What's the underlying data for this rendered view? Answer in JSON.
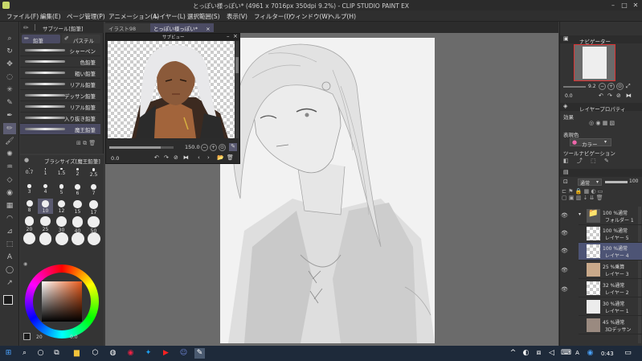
{
  "window": {
    "title": "とっぽい様っぽい* (4961 x 7016px 350dpi 9.2%) - CLIP STUDIO PAINT EX"
  },
  "menu": [
    "ファイル(F)",
    "編集(E)",
    "ページ管理(P)",
    "アニメーション(A)",
    "レイヤー(L)",
    "選択範囲(S)",
    "表示(V)",
    "フィルター(I)",
    "ウィンドウ(W)",
    "ヘルプ(H)"
  ],
  "doc_tabs": [
    {
      "label": "イラスト98",
      "active": false
    },
    {
      "label": "とっぽい様っぽい*",
      "active": true
    }
  ],
  "subtool": {
    "header": "サブツール[鉛筆]",
    "tabs": [
      "鉛筆",
      "パステル"
    ],
    "brushes": [
      "シャーペン",
      "色鉛筆",
      "粗い鉛筆",
      "リアル鉛筆",
      "デッサン鉛筆",
      "リアル鉛筆",
      "入り抜き鉛筆",
      "魔王鉛筆"
    ],
    "selected_brush": "魔王鉛筆"
  },
  "brush_size": {
    "header": "ブラシサイズ[魔王鉛筆]",
    "sizes": [
      "0.7",
      "1",
      "1.5",
      "2",
      "2.5",
      "3",
      "4",
      "5",
      "6",
      "7",
      "8",
      "10",
      "12",
      "15",
      "17",
      "20",
      "25",
      "30",
      "40",
      "50",
      "",
      "",
      "",
      "",
      ""
    ],
    "selected": "10"
  },
  "preview": {
    "header": "サブビュー",
    "zoom": "150.0",
    "rotation": "0.0"
  },
  "navigator": {
    "header": "ナビゲーター",
    "zoom": "9.2",
    "rotation": "0.0"
  },
  "layer_property": {
    "header": "レイヤープロパティ",
    "effect_label": "効果",
    "expression_label": "表現色",
    "expression_value": "カラー",
    "tool_nav_label": "ツールナビゲーション"
  },
  "layer_panel": {
    "blend_mode": "通常",
    "opacity": "100"
  },
  "layers": [
    {
      "mode": "100 %通常",
      "name": "フォルダー 1",
      "type": "folder"
    },
    {
      "mode": "100 %通常",
      "name": "レイヤー 5",
      "type": "raster"
    },
    {
      "mode": "100 %通常",
      "name": "レイヤー 4",
      "type": "raster",
      "selected": true
    },
    {
      "mode": "25 %乗算",
      "name": "レイヤー 3",
      "type": "raster"
    },
    {
      "mode": "32 %通常",
      "name": "レイヤー 2",
      "type": "raster"
    },
    {
      "mode": "30 %通常",
      "name": "レイヤー 1",
      "type": "raster"
    },
    {
      "mode": "45 %通常",
      "name": "3Dデッサン",
      "type": "3d"
    }
  ],
  "status": {
    "zoom": "20",
    "coords": "0.0"
  },
  "taskbar": {
    "time": "0:43",
    "ime": "A"
  },
  "colors": {
    "accent": "#5a5a72",
    "main_color": "#1a1a1a",
    "sub_color": "#ffffff"
  }
}
